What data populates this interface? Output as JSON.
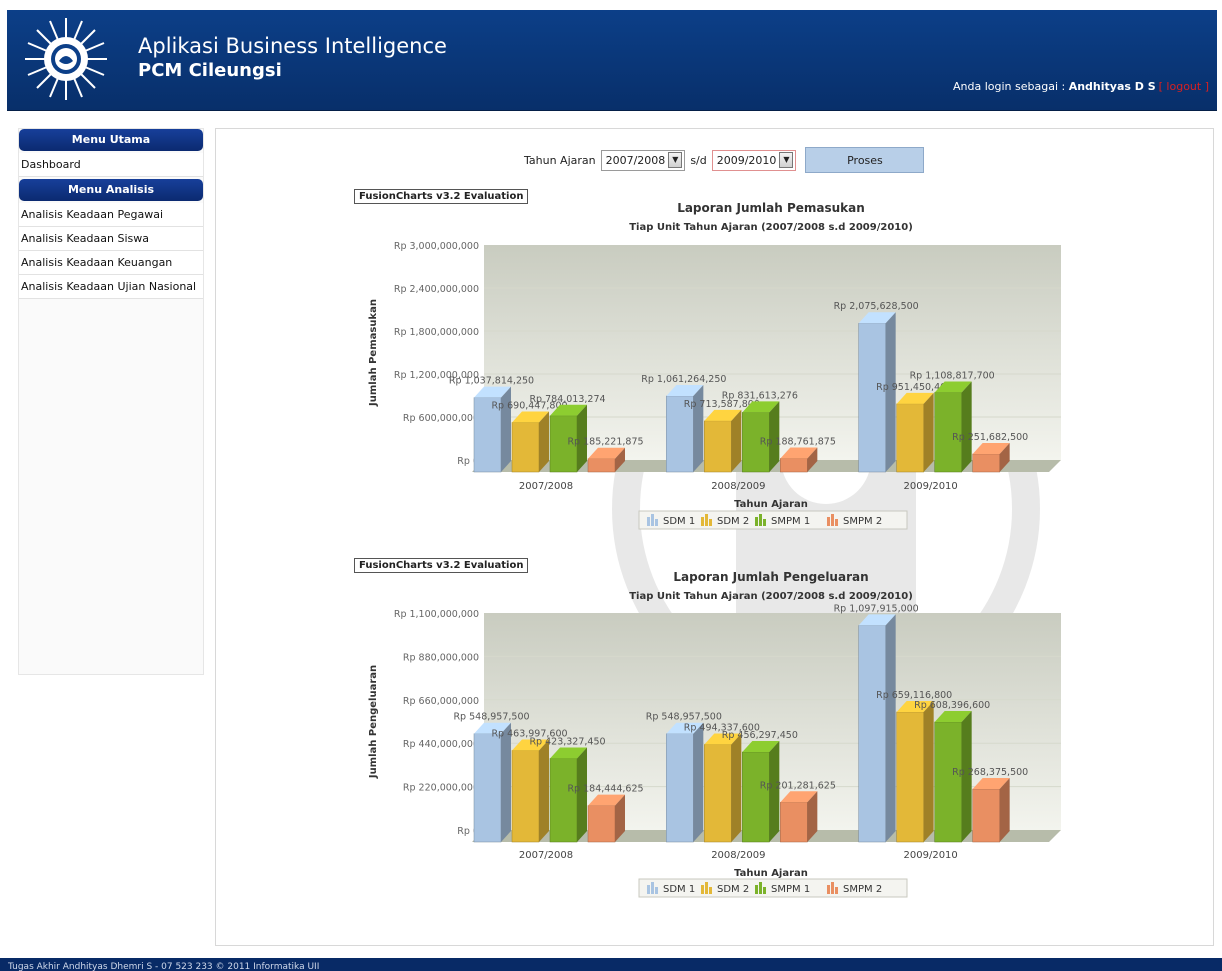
{
  "app": {
    "title_line1": "Aplikasi Business Intelligence",
    "title_line2": "PCM Cileungsi",
    "login_prefix": "Anda login sebagai : ",
    "login_user": "Andhityas D S",
    "logout_label": "[ logout ]"
  },
  "sidebar": {
    "menu_utama": "Menu Utama",
    "dashboard": "Dashboard",
    "menu_analisis": "Menu Analisis",
    "items": [
      {
        "label": "Analisis Keadaan Pegawai"
      },
      {
        "label": "Analisis Keadaan Siswa"
      },
      {
        "label": "Analisis Keadaan Keuangan"
      },
      {
        "label": "Analisis Keadaan Ujian Nasional"
      }
    ]
  },
  "filter": {
    "label": "Tahun Ajaran",
    "from_value": "2007/2008",
    "separator": "s/d",
    "to_value": "2009/2010",
    "button_label": "Proses"
  },
  "footer": {
    "text": "Tugas Akhir Andhityas Dhemri S - 07 523 233 © 2011 Informatika UII"
  },
  "colors": {
    "header": "#0c3f88",
    "sdm1": "#a9c4e2",
    "sdm2": "#e3b838",
    "smpm1": "#7bb22a",
    "smpm2": "#e98f62"
  },
  "chart_data": [
    {
      "type": "bar",
      "evaluation_label": "FusionCharts v3.2 Evaluation",
      "title": "Laporan Jumlah Pemasukan",
      "subtitle": "Tiap Unit Tahun Ajaran (2007/2008 s.d 2009/2010)",
      "xlabel": "Tahun Ajaran",
      "ylabel": "Jumlah Pemasukan",
      "ylim": [
        0,
        3000000000
      ],
      "yticks": [
        "Rp 3,000,000,000",
        "Rp 2,400,000,000",
        "Rp 1,800,000,000",
        "Rp 1,200,000,000",
        "Rp 600,000,000",
        "Rp 0"
      ],
      "categories": [
        "2007/2008",
        "2008/2009",
        "2009/2010"
      ],
      "series": [
        {
          "name": "SDM 1",
          "values": [
            1037814250,
            1061264250,
            2075628500
          ],
          "labels": [
            "Rp 1,037,814,250",
            "Rp 1,061,264,250",
            "Rp 2,075,628,500"
          ]
        },
        {
          "name": "SDM 2",
          "values": [
            690447800,
            713587800,
            951450400
          ],
          "labels": [
            "Rp 690,447,800",
            "Rp 713,587,800",
            "Rp 951,450,400"
          ]
        },
        {
          "name": "SMPM 1",
          "values": [
            784013274,
            831613276,
            1108817700
          ],
          "labels": [
            "Rp 784,013,274",
            "Rp 831,613,276",
            "Rp 1,108,817,700"
          ]
        },
        {
          "name": "SMPM 2",
          "values": [
            185221875,
            188761875,
            251682500
          ],
          "labels": [
            "Rp 185,221,875",
            "Rp 188,761,875",
            "Rp 251,682,500"
          ]
        }
      ],
      "legend": "bottom"
    },
    {
      "type": "bar",
      "evaluation_label": "FusionCharts v3.2 Evaluation",
      "title": "Laporan Jumlah Pengeluaran",
      "subtitle": "Tiap Unit Tahun Ajaran (2007/2008 s.d 2009/2010)",
      "xlabel": "Tahun Ajaran",
      "ylabel": "Jumlah Pengeluaran",
      "ylim": [
        0,
        1100000000
      ],
      "yticks": [
        "Rp 1,100,000,000",
        "Rp 880,000,000",
        "Rp 660,000,000",
        "Rp 440,000,000",
        "Rp 220,000,000",
        "Rp 0"
      ],
      "categories": [
        "2007/2008",
        "2008/2009",
        "2009/2010"
      ],
      "series": [
        {
          "name": "SDM 1",
          "values": [
            548957500,
            548957500,
            1097915000
          ],
          "labels": [
            "Rp 548,957,500",
            "Rp 548,957,500",
            "Rp 1,097,915,000"
          ]
        },
        {
          "name": "SDM 2",
          "values": [
            463997600,
            494337600,
            659116800
          ],
          "labels": [
            "Rp 463,997,600",
            "Rp 494,337,600",
            "Rp 659,116,800"
          ]
        },
        {
          "name": "SMPM 1",
          "values": [
            423327450,
            456297450,
            608396600
          ],
          "labels": [
            "Rp 423,327,450",
            "Rp 456,297,450",
            "Rp 608,396,600"
          ]
        },
        {
          "name": "SMPM 2",
          "values": [
            184444625,
            201281625,
            268375500
          ],
          "labels": [
            "Rp 184,444,625",
            "Rp 201,281,625",
            "Rp 268,375,500"
          ]
        }
      ],
      "legend": "bottom"
    }
  ]
}
